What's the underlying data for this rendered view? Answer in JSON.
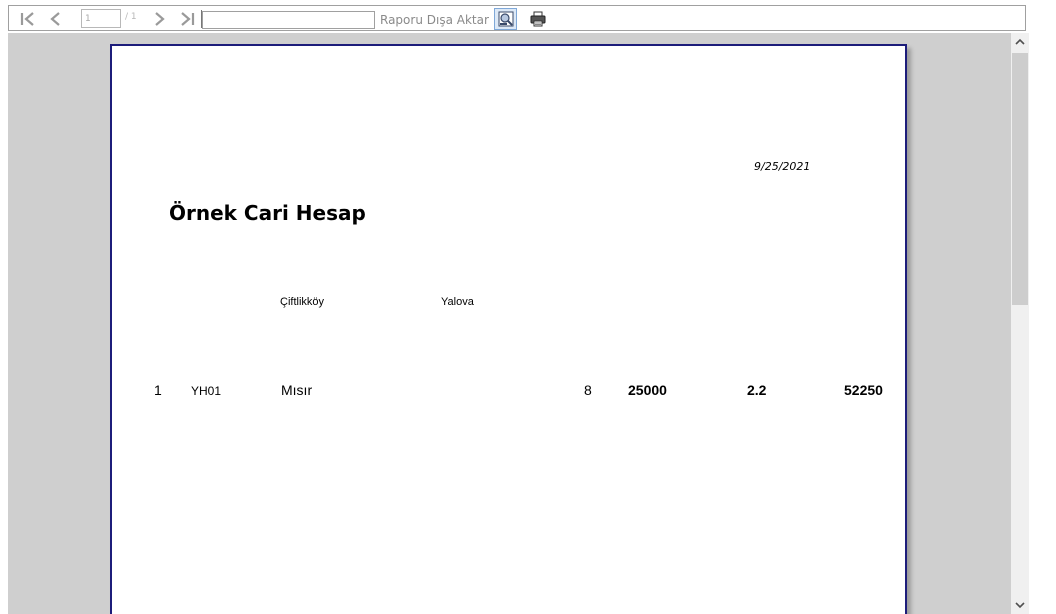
{
  "toolbar": {
    "page_current": "1",
    "page_total": "/ 1",
    "search_value": "",
    "export_label": "Raporu Dışa Aktar"
  },
  "report": {
    "date": "9/25/2021",
    "title": "Örnek Cari Hesap",
    "district": "Çiftlikköy",
    "city": "Yalova",
    "row": {
      "no": "1",
      "code": "YH01",
      "product": "Mısır",
      "quantity": "8",
      "price": "25000",
      "rate": "2.2",
      "total": "52250"
    }
  },
  "icons": {
    "first": "first-page-icon",
    "prev": "prev-page-icon",
    "next": "next-page-icon",
    "last": "last-page-icon",
    "export": "export-icon",
    "print": "printer-icon",
    "scroll_up": "chevron-up-icon",
    "scroll_down": "chevron-down-icon"
  },
  "colors": {
    "page_border": "#1c1c7a",
    "viewer_background": "#cfcfcf",
    "export_button_bg": "#dde9f7"
  }
}
